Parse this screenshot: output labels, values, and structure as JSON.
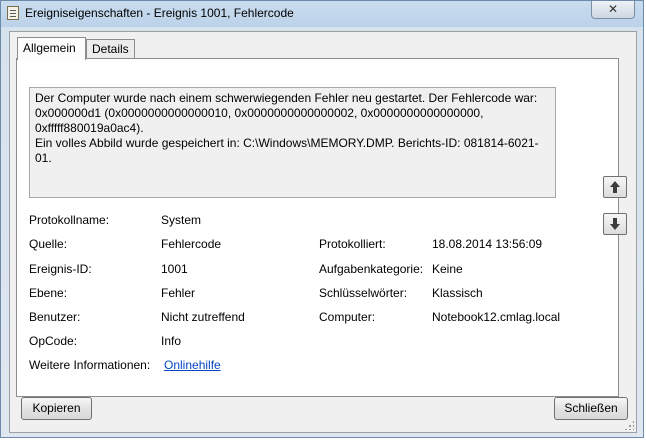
{
  "window": {
    "title": "Ereigniseigenschaften - Ereignis 1001, Fehlercode",
    "close_glyph": "✕"
  },
  "tabs": [
    {
      "label": "Allgemein",
      "active": true
    },
    {
      "label": "Details",
      "active": false
    }
  ],
  "description": "Der Computer wurde nach einem schwerwiegenden Fehler neu gestartet. Der Fehlercode war:\n0x000000d1 (0x0000000000000010, 0x0000000000000002, 0x0000000000000000, 0xfffff880019a0ac4).\nEin volles Abbild wurde gespeichert in: C:\\Windows\\MEMORY.DMP. Berichts-ID: 081814-6021-01.",
  "fields": {
    "protokollname": {
      "label": "Protokollname:",
      "value": "System"
    },
    "quelle": {
      "label": "Quelle:",
      "value": "Fehlercode"
    },
    "protokolliert": {
      "label": "Protokolliert:",
      "value": "18.08.2014 13:56:09"
    },
    "ereignis_id": {
      "label": "Ereignis-ID:",
      "value": "1001"
    },
    "aufgabenkategorie": {
      "label": "Aufgabenkategorie:",
      "value": "Keine"
    },
    "ebene": {
      "label": "Ebene:",
      "value": "Fehler"
    },
    "schluesselwoerter": {
      "label": "Schlüsselwörter:",
      "value": "Klassisch"
    },
    "benutzer": {
      "label": "Benutzer:",
      "value": "Nicht zutreffend"
    },
    "computer": {
      "label": "Computer:",
      "value": "Notebook12.cmlag.local"
    },
    "opcode": {
      "label": "OpCode:",
      "value": "Info"
    },
    "weitere_informationen": {
      "label": "Weitere Informationen:",
      "value": "Onlinehilfe"
    }
  },
  "nav": {
    "up_icon": "arrow-up-icon",
    "down_icon": "arrow-down-icon"
  },
  "buttons": {
    "copy": "Kopieren",
    "close": "Schließen"
  }
}
